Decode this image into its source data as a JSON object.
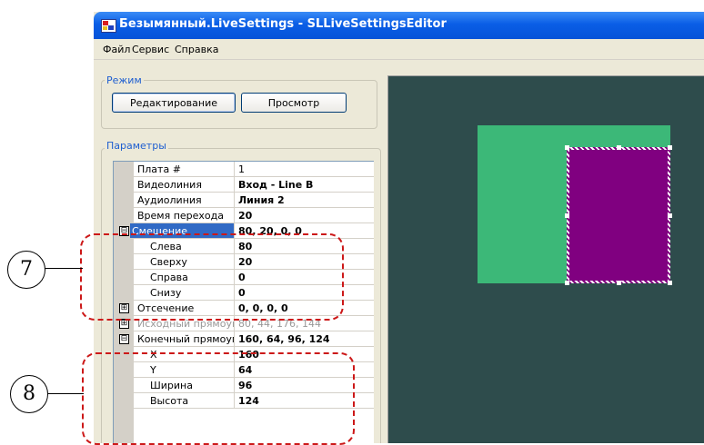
{
  "window": {
    "title": "Безымянный.LiveSettings - SLLiveSettingsEditor"
  },
  "menu": {
    "file": "Файл",
    "service": "Сервис",
    "help": "Справка"
  },
  "mode": {
    "label": "Режим",
    "edit_button": "Редактирование",
    "view_button": "Просмотр"
  },
  "params": {
    "label": "Параметры",
    "rows": [
      {
        "name": "Плата #",
        "value": "1"
      },
      {
        "name": "Видеолиния",
        "value": "Вход - Line B"
      },
      {
        "name": "Аудиолиния",
        "value": "Линия 2"
      },
      {
        "name": "Время перехода",
        "value": "20"
      },
      {
        "name": "Смещение",
        "value": "80, 20, 0, 0",
        "toggle": "⊟"
      },
      {
        "name": "Слева",
        "value": "80"
      },
      {
        "name": "Сверху",
        "value": "20"
      },
      {
        "name": "Справа",
        "value": "0"
      },
      {
        "name": "Снизу",
        "value": "0"
      },
      {
        "name": "Отсечение",
        "value": "0, 0, 0, 0",
        "toggle": "⊞"
      },
      {
        "name": "Исходный прямоугольник",
        "value": "80, 44, 176, 144",
        "toggle": "⊞"
      },
      {
        "name": "Конечный прямоугольник",
        "value": "160, 64, 96, 124",
        "toggle": "⊟"
      },
      {
        "name": "X",
        "value": "160"
      },
      {
        "name": "Y",
        "value": "64"
      },
      {
        "name": "Ширина",
        "value": "96"
      },
      {
        "name": "Высота",
        "value": "124"
      }
    ]
  },
  "callouts": {
    "c7": "7",
    "c8": "8"
  },
  "colors": {
    "preview_bg": "#2e4c4c",
    "background_rect": "#3cb878",
    "foreground_rect": "#800080",
    "selection": "#316ac5",
    "callout_dash": "#cc1818"
  }
}
